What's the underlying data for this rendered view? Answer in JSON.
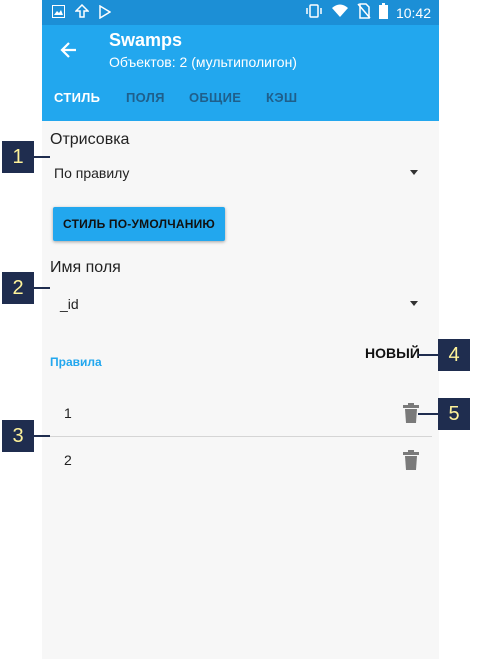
{
  "status_bar": {
    "time": "10:42",
    "left_icons": [
      "image-icon",
      "upload-icon",
      "play-store-icon"
    ],
    "right_icons": [
      "vibrate-icon",
      "wifi-icon",
      "no-sim-icon",
      "battery-icon"
    ]
  },
  "app_bar": {
    "title": "Swamps",
    "subtitle": "Объектов: 2 (мультиполигон)",
    "back_icon": "arrow-left-icon"
  },
  "tabs": [
    {
      "label": "СТИЛЬ",
      "active": true
    },
    {
      "label": "ПОЛЯ",
      "active": false
    },
    {
      "label": "ОБЩИЕ",
      "active": false
    },
    {
      "label": "КЭШ",
      "active": false
    }
  ],
  "render": {
    "label": "Отрисовка",
    "value": "По правилу"
  },
  "default_style_button": "СТИЛЬ ПО-УМОЛЧАНИЮ",
  "field": {
    "label": "Имя поля",
    "value": "_id"
  },
  "rules": {
    "title": "Правила",
    "new_button": "НОВЫЙ",
    "items": [
      {
        "value": "1"
      },
      {
        "value": "2"
      }
    ]
  },
  "callouts": [
    "1",
    "2",
    "3",
    "4",
    "5"
  ],
  "colors": {
    "primary": "#22a7ee",
    "status_bar": "#1c8fd6",
    "callout_bg": "#1f2d4f",
    "callout_text": "#fff39a"
  }
}
